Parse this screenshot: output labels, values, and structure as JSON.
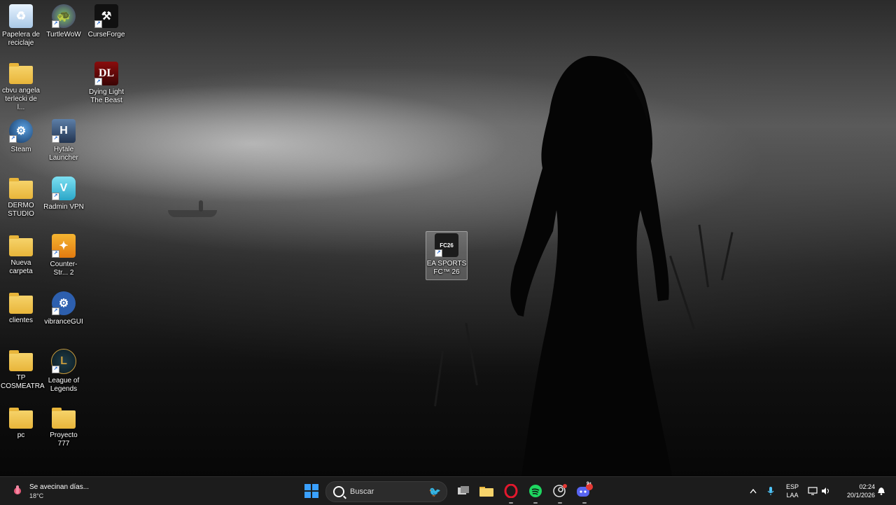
{
  "desktop": {
    "icons": [
      {
        "label": "Papelera de reciclaje",
        "icon": "recycle-bin-icon",
        "type": "system"
      },
      {
        "label": "TurtleWoW",
        "icon": "turtlewow-icon",
        "type": "shortcut"
      },
      {
        "label": "CurseForge",
        "icon": "curseforge-icon",
        "type": "shortcut"
      },
      {
        "label": "cbvu angela terlecki de l...",
        "icon": "folder-icon",
        "type": "folder"
      },
      {
        "label": "Dying Light The Beast",
        "icon": "dying-light-icon",
        "type": "shortcut"
      },
      {
        "label": "Steam",
        "icon": "steam-icon",
        "type": "shortcut"
      },
      {
        "label": "Hytale Launcher",
        "icon": "hytale-icon",
        "type": "shortcut"
      },
      {
        "label": "DERMO STUDIO",
        "icon": "folder-icon",
        "type": "folder"
      },
      {
        "label": "Radmin VPN",
        "icon": "radmin-vpn-icon",
        "type": "shortcut"
      },
      {
        "label": "Nueva carpeta",
        "icon": "folder-icon",
        "type": "folder"
      },
      {
        "label": "Counter-Str... 2",
        "icon": "counter-strike-icon",
        "type": "shortcut"
      },
      {
        "label": "clientes",
        "icon": "folder-icon",
        "type": "folder"
      },
      {
        "label": "vibranceGUI",
        "icon": "gear-icon",
        "type": "shortcut"
      },
      {
        "label": "TP COSMEATRA",
        "icon": "folder-icon",
        "type": "folder"
      },
      {
        "label": "League of Legends",
        "icon": "league-of-legends-icon",
        "type": "shortcut"
      },
      {
        "label": "pc",
        "icon": "folder-icon",
        "type": "folder"
      },
      {
        "label": "Proyecto 777",
        "icon": "folder-icon",
        "type": "folder"
      },
      {
        "label": "EA SPORTS FC™ 26",
        "icon": "ea-fc26-icon",
        "type": "shortcut",
        "badge": "FC26"
      }
    ]
  },
  "taskbar": {
    "weather": {
      "title": "Se avecinan días...",
      "temp": "18°C",
      "icon": "weather-icon"
    },
    "search_label": "Buscar",
    "apps": [
      {
        "name": "task-view",
        "icon": "task-view-icon"
      },
      {
        "name": "file-explorer",
        "icon": "folder-icon"
      },
      {
        "name": "opera",
        "icon": "opera-icon"
      },
      {
        "name": "spotify",
        "icon": "spotify-icon"
      },
      {
        "name": "steam",
        "icon": "steam-icon"
      },
      {
        "name": "discord",
        "icon": "discord-icon",
        "badge": "9+"
      }
    ],
    "tray": {
      "lang_top": "ESP",
      "lang_bottom": "LAA",
      "time": "02:24",
      "date": "20/1/2026"
    }
  },
  "colors": {
    "taskbar_bg": "#1c1c1c",
    "folder": "#e8b53a",
    "start_blue": "#3aa0ff"
  }
}
